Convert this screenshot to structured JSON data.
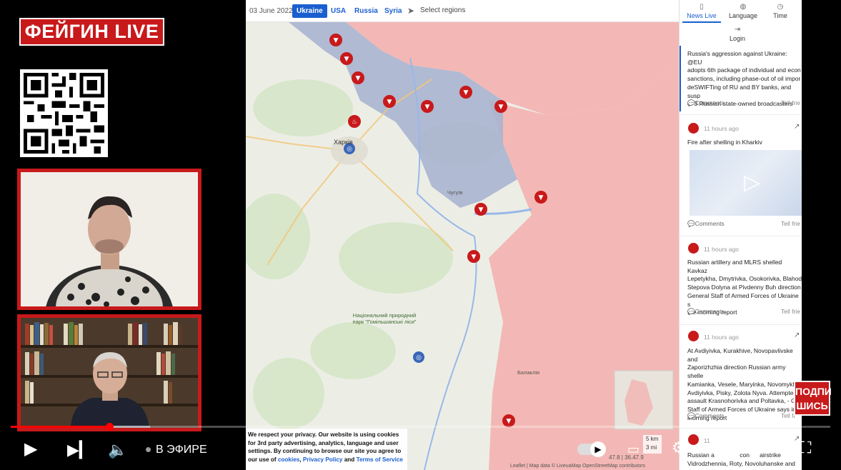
{
  "channel": {
    "logo_text": "ФЕЙГИН LIVE",
    "subscribe_line1": "ПОДПИ",
    "subscribe_line2": "ШИСЬ"
  },
  "map_header": {
    "date": "03 June 2022",
    "tabs": [
      {
        "label": "Ukraine",
        "active": true
      },
      {
        "label": "USA",
        "active": false
      },
      {
        "label": "Russia",
        "active": false
      },
      {
        "label": "Syria",
        "active": false
      }
    ],
    "select_regions": "Select regions"
  },
  "map_labels": {
    "kharkiv": "Харків",
    "natural_park": "Національний природний парк \"Гомільшанські ліси\"",
    "balakliia": "Балаклія",
    "chuhuiv": "Чугуїв",
    "scale_km": "5 km",
    "scale_mi": "3 mi",
    "coords": "47.8 | 36.47.9",
    "attribution": "Leaflet | Map data © LiveuaMap OpenStreetMap contributors"
  },
  "side_nav": [
    {
      "label": "News Live",
      "icon": "news-icon",
      "active": true
    },
    {
      "label": "Language",
      "icon": "globe-icon",
      "active": false
    },
    {
      "label": "Time",
      "icon": "clock-icon",
      "active": false
    },
    {
      "label": "Login",
      "icon": "login-icon",
      "active": false
    }
  ],
  "posts": [
    {
      "time": "",
      "text": "Russia's aggression against Ukraine: @EU\nadopts 6th package of individual and econ\nsanctions, including phase-out of oil impor\ndeSWIFTing of RU and BY banks, and susp\nof 3 Russian state-owned broadcasters",
      "comments": "Comments",
      "tell": "Tell frie"
    },
    {
      "time": "11 hours ago",
      "text": "Fire after shelling in Kharkiv",
      "comments": "Comments",
      "tell": "Tell frie"
    },
    {
      "time": "11 hours ago",
      "text": "Russian artillery and MLRS shelled Kavkaz\nLepetykha, Dmytrivka, Osokorivka, Blahod\nStepova Dolyna at Pivdenny Buh direction\nGeneral Staff of Armed Forces of Ukraine s\nthe morning report",
      "comments": "Comments",
      "tell": "Tell frie"
    },
    {
      "time": "11 hours ago",
      "text": "At Avdiyivka, Kurakhive, Novopavlivske and\nZaporizhzhia direction Russian army shelle\nKamianka, Vesele, Maryinka, Novomykhail\nAvdiyivka, Pisky, Zolota Nyva. Attempted t\nassault Krasnohorivka and Poltavka, - G\nStaff of Armed Forces of Ukraine says in\nmorning report",
      "comments": "Comments",
      "tell": "Tell fr"
    },
    {
      "time": "11 ",
      "text": "Russian a               con      airstrike\nVidrodzhennia, Roty, Novoluhanske and",
      "comments": "",
      "tell": ""
    }
  ],
  "privacy": {
    "text": "We respect your privacy. Our website is using cookies for 3rd party advertising, analytics, language and user settings. By continuing to browse our site you agree to our use of",
    "link1": "cookies",
    "sep1": ",",
    "link2": "Privacy Policy",
    "and": "and",
    "link3": "Terms of Service"
  },
  "player": {
    "live_label": "В ЭФИРЕ",
    "progress": 0.12,
    "buffer": 0.17,
    "colors": {
      "progress": "#ff0000",
      "brand": "#c8191b",
      "occupied": "#f3b3b1",
      "contested": "#aab4cf",
      "link": "#1a5fcf"
    }
  }
}
